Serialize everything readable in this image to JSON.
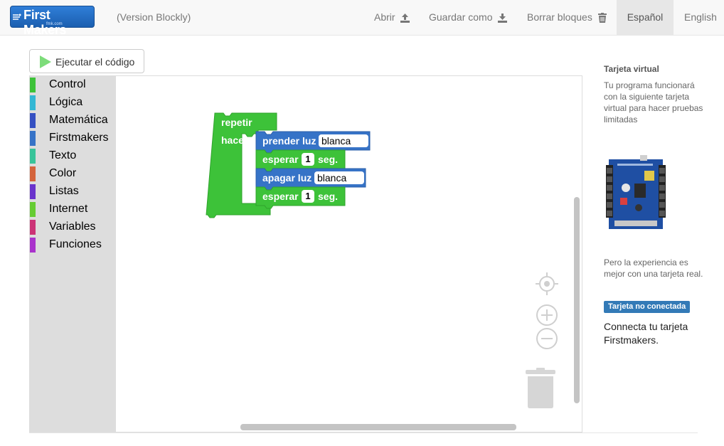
{
  "navbar": {
    "logo_text": "First Makers",
    "logo_sub": "fmk.com",
    "version": "(Version Blockly)",
    "open_label": "Abrir",
    "save_as_label": "Guardar como",
    "clear_label": "Borrar bloques",
    "lang_es": "Español",
    "lang_en": "English",
    "active_language": "Español"
  },
  "run_button": {
    "label": "Ejecutar el código"
  },
  "toolbox": {
    "categories": [
      {
        "label": "Control",
        "color": "#3dc239"
      },
      {
        "label": "Lógica",
        "color": "#33b7d4"
      },
      {
        "label": "Matemática",
        "color": "#3550c2"
      },
      {
        "label": "Firstmakers",
        "color": "#3673c7"
      },
      {
        "label": "Texto",
        "color": "#38c49a"
      },
      {
        "label": "Color",
        "color": "#d4643c"
      },
      {
        "label": "Listas",
        "color": "#6a33cc"
      },
      {
        "label": "Internet",
        "color": "#66cc33"
      },
      {
        "label": "Variables",
        "color": "#cc3377"
      },
      {
        "label": "Funciones",
        "color": "#aa33cc"
      }
    ]
  },
  "blocks": {
    "repeat_label": "repetir",
    "do_label": "hacer",
    "turn_on": "prender luz",
    "turn_off": "apagar luz",
    "light_value_1": "blanca",
    "light_value_2": "blanca",
    "wait_label": "esperar",
    "wait_value_1": "1",
    "wait_value_2": "1",
    "seconds_label": "seg.",
    "control_color": "#3dc239",
    "firstmakers_color": "#3673c7"
  },
  "right_panel": {
    "title": "Tarjeta virtual",
    "description": "Tu programa funcionará con la siguiente tarjeta virtual para hacer pruebas limitadas",
    "experience": "Pero la experiencia es mejor con una tarjeta real.",
    "status_badge": "Tarjeta no conectada",
    "connect_text": "Connecta tu tarjeta Firstmakers."
  }
}
